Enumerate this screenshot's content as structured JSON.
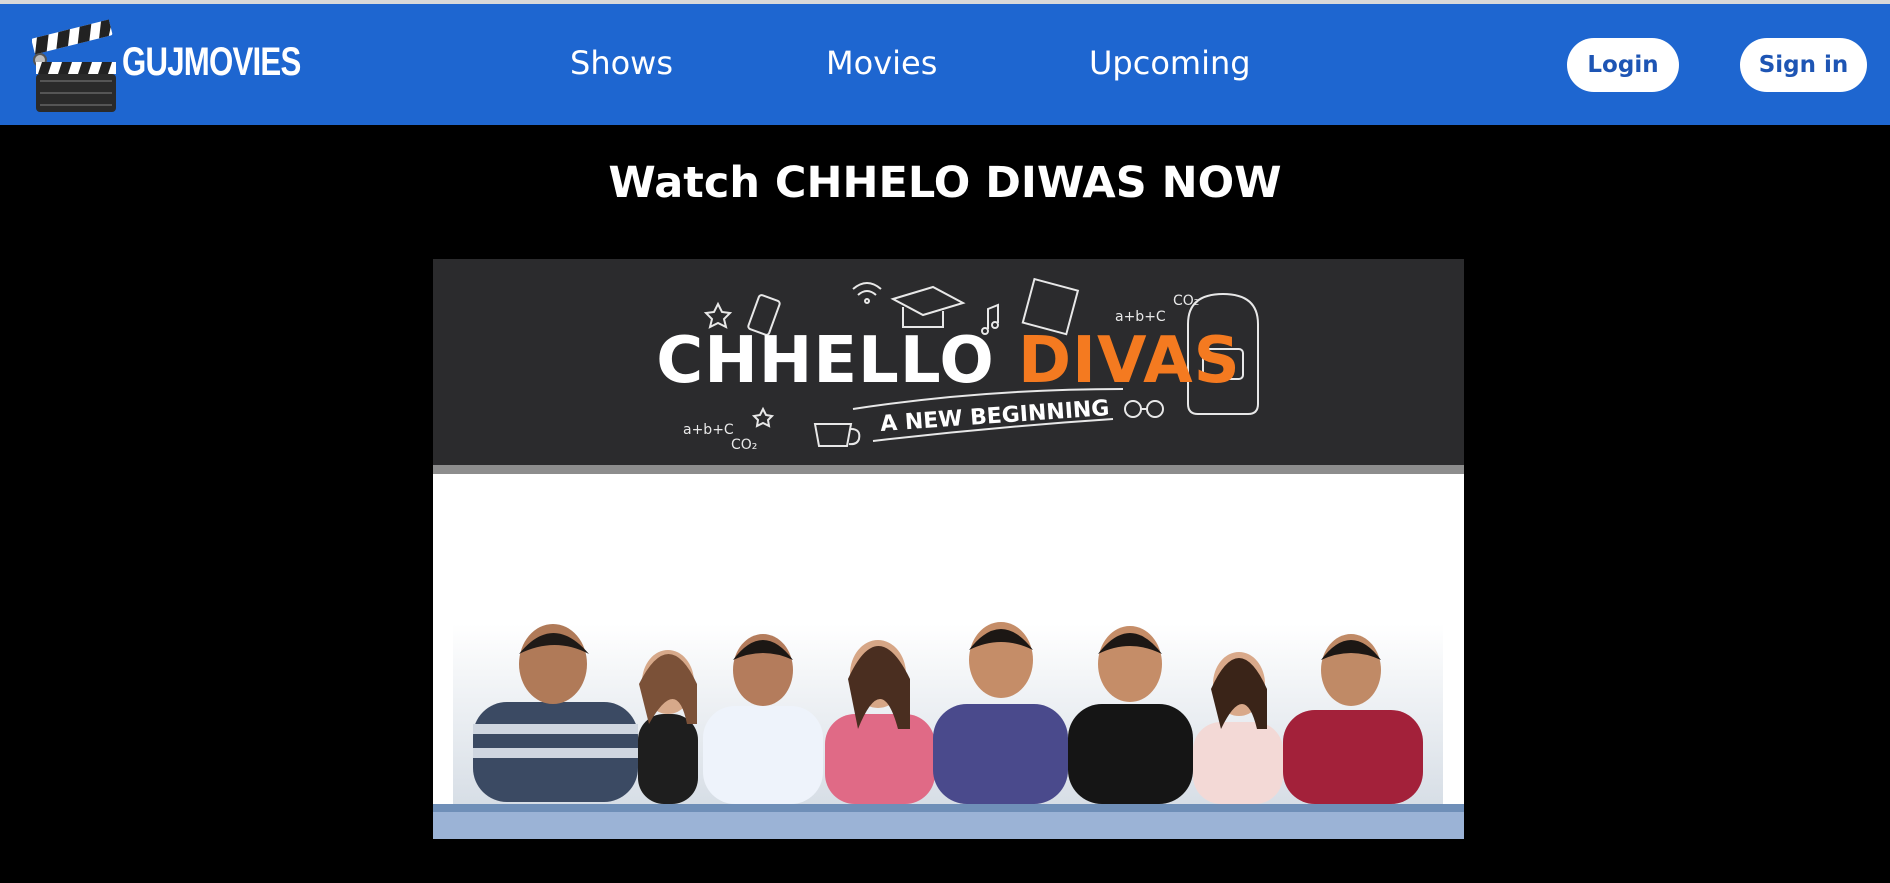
{
  "brand": {
    "name": "GUJMOVIES",
    "logo_icon": "clapperboard-icon"
  },
  "nav": {
    "shows": "Shows",
    "movies": "Movies",
    "upcoming": "Upcoming"
  },
  "auth": {
    "login": "Login",
    "signin": "Sign in"
  },
  "hero": {
    "headline": "Watch CHHELO DIWAS NOW",
    "poster": {
      "title_part1": "CHHELLO",
      "title_part2": "DIVAS",
      "tagline": "A NEW BEGINNING"
    }
  },
  "colors": {
    "nav_bg": "#1e66d0",
    "page_bg": "#000000",
    "accent_orange": "#f47a20",
    "button_text": "#1e55b4"
  }
}
